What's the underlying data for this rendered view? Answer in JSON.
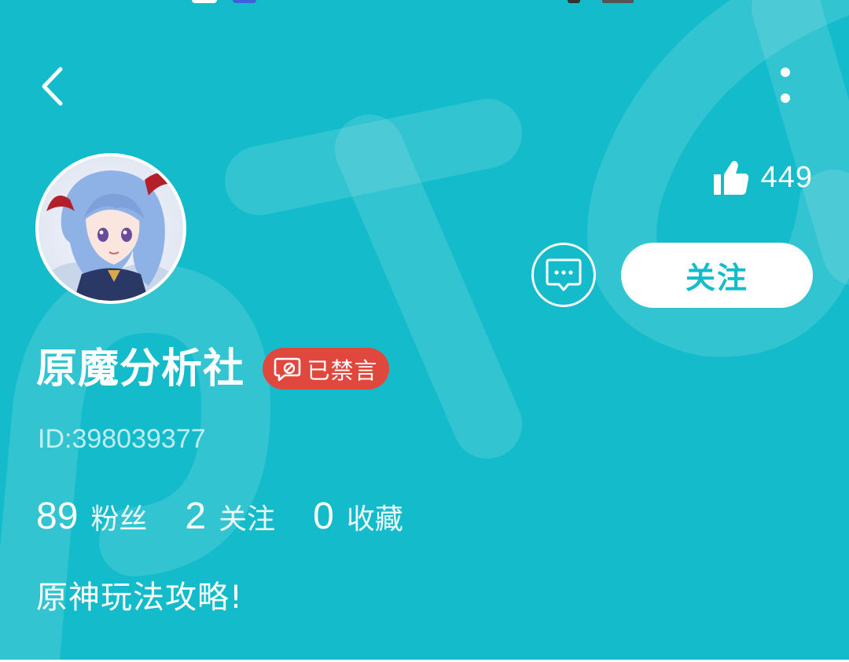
{
  "profile": {
    "name": "原魔分析社",
    "muted_badge": "已禁言",
    "id_text": "ID:398039377",
    "likes": "449",
    "follow_label": "关注",
    "bio": "原神玩法攻略!",
    "stats": [
      {
        "value": "89",
        "label": "粉丝"
      },
      {
        "value": "2",
        "label": "关注"
      },
      {
        "value": "0",
        "label": "收藏"
      }
    ]
  },
  "icons": {
    "back": "chevron-left-icon",
    "more": "more-vertical-icon",
    "like": "thumbs-up-icon",
    "message": "chat-bubble-icon",
    "muted": "muted-chat-icon"
  },
  "colors": {
    "header_background": "#14bccb",
    "follow_text": "#14bccb",
    "muted_badge": "#e0483d"
  }
}
